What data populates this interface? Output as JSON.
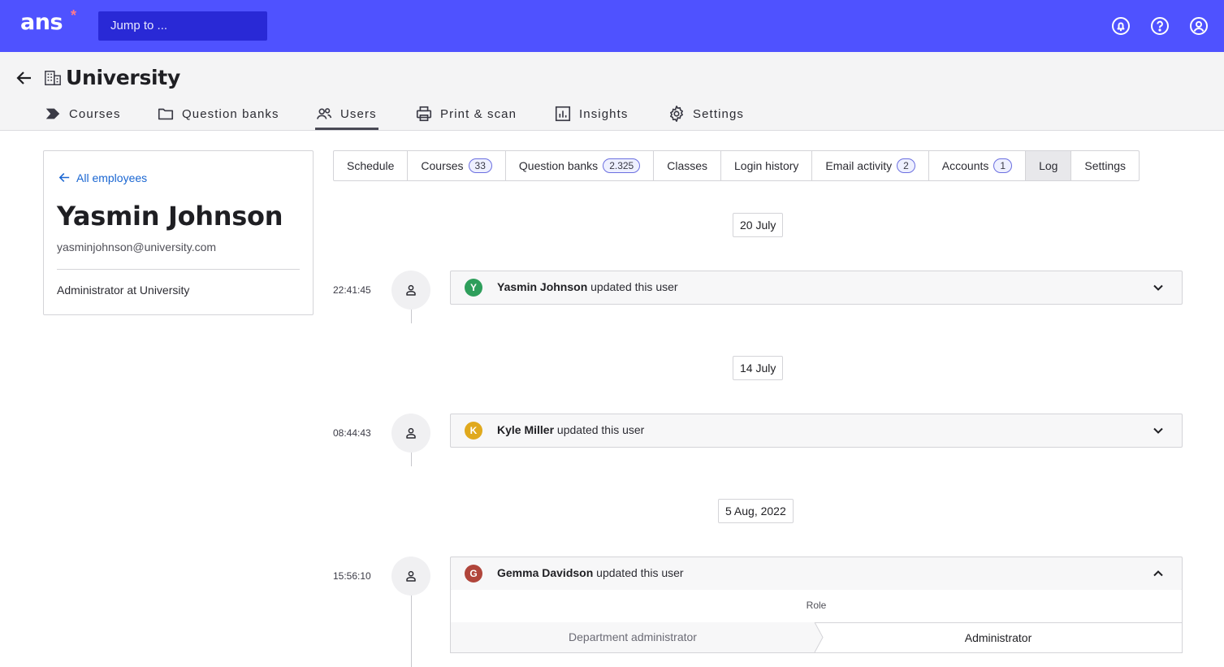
{
  "topbar": {
    "logo": "ans",
    "logo_star": "*",
    "search_placeholder": "Jump to ...",
    "icons": [
      "notifications-icon",
      "help-icon",
      "account-icon"
    ]
  },
  "header": {
    "title": "University",
    "nav": [
      {
        "label": "Courses",
        "icon": "courses-icon"
      },
      {
        "label": "Question banks",
        "icon": "folder-icon"
      },
      {
        "label": "Users",
        "icon": "users-icon",
        "active": true
      },
      {
        "label": "Print & scan",
        "icon": "printer-icon"
      },
      {
        "label": "Insights",
        "icon": "chart-icon"
      },
      {
        "label": "Settings",
        "icon": "gear-icon"
      }
    ]
  },
  "profile": {
    "back_label": "All employees",
    "name": "Yasmin Johnson",
    "email": "yasminjohnson@university.com",
    "role": "Administrator at University"
  },
  "subtabs": [
    {
      "label": "Schedule"
    },
    {
      "label": "Courses",
      "count": "33"
    },
    {
      "label": "Question banks",
      "count": "2.325"
    },
    {
      "label": "Classes"
    },
    {
      "label": "Login history"
    },
    {
      "label": "Email activity",
      "count": "2"
    },
    {
      "label": "Accounts",
      "count": "1"
    },
    {
      "label": "Log",
      "active": true
    },
    {
      "label": "Settings"
    }
  ],
  "log": [
    {
      "date": "20 July",
      "time": "22:41:45",
      "initial": "Y",
      "avatar_color": "#2e9e5b",
      "actor": "Yasmin Johnson",
      "action": "updated this user",
      "expanded": false
    },
    {
      "date": "14 July",
      "time": "08:44:43",
      "initial": "K",
      "avatar_color": "#e0a91d",
      "actor": "Kyle Miller",
      "action": "updated this user",
      "expanded": false
    },
    {
      "date": "5 Aug, 2022",
      "time": "15:56:10",
      "initial": "G",
      "avatar_color": "#b0453b",
      "actor": "Gemma Davidson",
      "action": "updated this user",
      "expanded": true,
      "change": {
        "field": "Role",
        "old": "Department administrator",
        "new": "Administrator"
      }
    }
  ],
  "colors": {
    "brand": "#4f52ff",
    "search_bg": "#2929d6",
    "link": "#1a66d2"
  }
}
